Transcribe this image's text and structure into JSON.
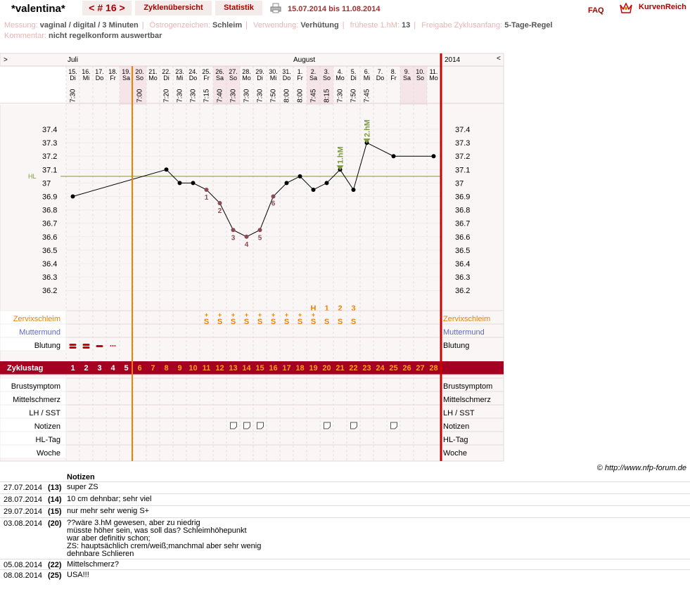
{
  "header": {
    "user_name": "*valentina*",
    "cycle_label": "< # 16 >",
    "tab_overview": "Zyklenübersicht",
    "tab_statistics": "Statistik",
    "date_range": "15.07.2014 bis 11.08.2014",
    "faq": "FAQ",
    "brand": "KurvenReich"
  },
  "meta": {
    "messung_label": "Messung:",
    "messung": "vaginal / digital / 3 Minuten",
    "oestrogen_label": "Östrogenzeichen:",
    "oestrogen": "Schleim",
    "verwendung_label": "Verwendung:",
    "verwendung": "Verhütung",
    "fhm_label": "früheste 1.hM:",
    "fhm": "13",
    "freigabe_label": "Freigabe Zyklusanfang:",
    "freigabe": "5-Tage-Regel",
    "kommentar_label": "Kommentar:",
    "kommentar": "nicht regelkonform auswertbar"
  },
  "chart_data": {
    "type": "line",
    "months": {
      "left_arrow": ">",
      "july": "Juli",
      "august": "August",
      "year": "2014",
      "right_arrow": "<"
    },
    "days": [
      {
        "d": "15.",
        "w": "Di",
        "t": "7:30",
        "we": false
      },
      {
        "d": "16.",
        "w": "Mi",
        "t": "",
        "we": false
      },
      {
        "d": "17.",
        "w": "Do",
        "t": "",
        "we": false
      },
      {
        "d": "18.",
        "w": "Fr",
        "t": "",
        "we": false
      },
      {
        "d": "19.",
        "w": "Sa",
        "t": "",
        "we": true
      },
      {
        "d": "20.",
        "w": "So",
        "t": "7:00",
        "we": true
      },
      {
        "d": "21.",
        "w": "Mo",
        "t": "",
        "we": false
      },
      {
        "d": "22.",
        "w": "Di",
        "t": "7:20",
        "we": false
      },
      {
        "d": "23.",
        "w": "Mi",
        "t": "7:30",
        "we": false
      },
      {
        "d": "24.",
        "w": "Do",
        "t": "7:30",
        "we": false
      },
      {
        "d": "25.",
        "w": "Fr",
        "t": "7:15",
        "we": false
      },
      {
        "d": "26.",
        "w": "Sa",
        "t": "7:40",
        "we": true
      },
      {
        "d": "27.",
        "w": "So",
        "t": "7:30",
        "we": true
      },
      {
        "d": "28.",
        "w": "Mo",
        "t": "7:30",
        "we": false
      },
      {
        "d": "29.",
        "w": "Di",
        "t": "7:30",
        "we": false
      },
      {
        "d": "30.",
        "w": "Mi",
        "t": "7:50",
        "we": false
      },
      {
        "d": "31.",
        "w": "Do",
        "t": "8:00",
        "we": false
      },
      {
        "d": "1.",
        "w": "Fr",
        "t": "8:00",
        "we": false
      },
      {
        "d": "2.",
        "w": "Sa",
        "t": "7:45",
        "we": true
      },
      {
        "d": "3.",
        "w": "So",
        "t": "8:15",
        "we": true
      },
      {
        "d": "4.",
        "w": "Mo",
        "t": "7:30",
        "we": false
      },
      {
        "d": "5.",
        "w": "Di",
        "t": "7:50",
        "we": false
      },
      {
        "d": "6.",
        "w": "Mi",
        "t": "7:45",
        "we": false
      },
      {
        "d": "7.",
        "w": "Do",
        "t": "",
        "we": false
      },
      {
        "d": "8.",
        "w": "Fr",
        "t": "",
        "we": false
      },
      {
        "d": "9.",
        "w": "Sa",
        "t": "",
        "we": true
      },
      {
        "d": "10.",
        "w": "So",
        "t": "",
        "we": true
      },
      {
        "d": "11.",
        "w": "Mo",
        "t": "",
        "we": false
      }
    ],
    "temps": [
      36.9,
      null,
      null,
      null,
      null,
      null,
      null,
      37.1,
      37.0,
      37.0,
      36.95,
      36.85,
      36.65,
      36.6,
      36.65,
      36.9,
      37.0,
      37.05,
      36.95,
      37.0,
      37.1,
      36.95,
      37.3,
      null,
      37.2,
      null,
      null,
      37.2
    ],
    "lower_labels": [
      {
        "day": 11,
        "n": "1"
      },
      {
        "day": 12,
        "n": "2"
      },
      {
        "day": 13,
        "n": "3"
      },
      {
        "day": 14,
        "n": "4"
      },
      {
        "day": 15,
        "n": "5"
      },
      {
        "day": 16,
        "n": "6"
      }
    ],
    "higher_markers": [
      {
        "day": 21,
        "label": "1.hM"
      },
      {
        "day": 23,
        "label": "2.hM"
      }
    ],
    "y_ticks": [
      "37.4",
      "37.3",
      "37.2",
      "37.1",
      "37",
      "36.9",
      "36.8",
      "36.7",
      "36.6",
      "36.5",
      "36.4",
      "36.3",
      "36.2"
    ],
    "hl_value": 37.05,
    "hl_label": "HL",
    "ylim": [
      36.2,
      37.4
    ],
    "peak_labels": [
      {
        "day": 19,
        "t": "H"
      },
      {
        "day": 20,
        "t": "1"
      },
      {
        "day": 21,
        "t": "2"
      },
      {
        "day": 22,
        "t": "3"
      }
    ],
    "mucus_plus_days": [
      11,
      12,
      13,
      14,
      15,
      16,
      17,
      18,
      19
    ],
    "mucus_plain_days": [
      20,
      21,
      22
    ],
    "mucus_symbol": "S",
    "mucus_plus": "+",
    "bleeding": [
      3,
      3,
      2,
      1,
      0
    ],
    "note_days": [
      13,
      14,
      15,
      20,
      22,
      25
    ],
    "cover_line_day": 6,
    "rows": {
      "zervix": "Zervixschleim",
      "muttermund": "Muttermund",
      "blutung": "Blutung",
      "zyklustag": "Zyklustag",
      "brust": "Brustsymptom",
      "mittel": "Mittelschmerz",
      "lh": "LH / SST",
      "notizen": "Notizen",
      "hltag": "HL-Tag",
      "woche": "Woche"
    }
  },
  "copyright": "© http://www.nfp-forum.de",
  "notes": {
    "header": "Notizen",
    "entries": [
      {
        "date": "27.07.2014",
        "cd": "(13)",
        "text": "super ZS"
      },
      {
        "date": "28.07.2014",
        "cd": "(14)",
        "text": "10 cm dehnbar; sehr viel"
      },
      {
        "date": "29.07.2014",
        "cd": "(15)",
        "text": "nur mehr sehr wenig S+"
      },
      {
        "date": "03.08.2014",
        "cd": "(20)",
        "text": "??wäre 3.hM gewesen, aber zu niedrig\nmüsste höher sein, was soll das? Schleimhöhepunkt\nwar aber definitiv schon;\nZS: hauptsächlich crem/weiß;manchmal aber sehr wenig\ndehnbare Schlieren"
      },
      {
        "date": "05.08.2014",
        "cd": "(22)",
        "text": "Mittelschmerz?"
      },
      {
        "date": "08.08.2014",
        "cd": "(25)",
        "text": "USA!!!"
      }
    ]
  },
  "colors": {
    "brand": "#aa0000",
    "zyklustag_bg": "#a50021",
    "weekend": "#f5e4e8",
    "cover": "#f08000",
    "hl": "#7a9a3c",
    "low": "#8c4a55",
    "peak": "#f08000"
  }
}
